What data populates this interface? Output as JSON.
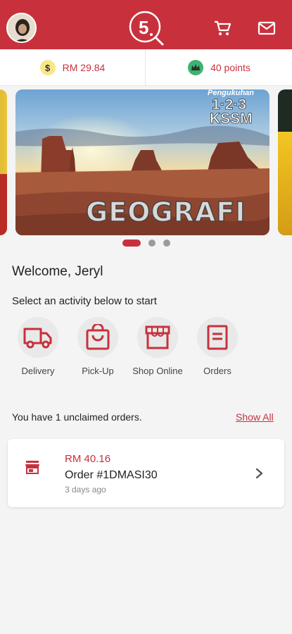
{
  "header": {
    "logo_text": "5",
    "accent_color": "#c8313c"
  },
  "balance": {
    "cash_symbol": "$",
    "cash": "RM 29.84",
    "points": "40 points"
  },
  "banner": {
    "title": "GEOGRAFI",
    "kicker": "Pengukuhan",
    "number": "1·2·3",
    "subject": "KSSM",
    "slide_count": 3,
    "active_slide": 1
  },
  "welcome": {
    "greeting": "Welcome, Jeryl",
    "instruction": "Select an activity below to start"
  },
  "activities": [
    {
      "label": "Delivery",
      "icon": "truck-icon"
    },
    {
      "label": "Pick-Up",
      "icon": "shopping-bag-icon"
    },
    {
      "label": "Shop Online",
      "icon": "storefront-icon"
    },
    {
      "label": "Orders",
      "icon": "receipt-icon"
    }
  ],
  "unclaimed": {
    "message": "You have 1 unclaimed orders.",
    "show_all": "Show All"
  },
  "order": {
    "amount": "RM 40.16",
    "id": "Order #1DMASI30",
    "time": "3 days ago"
  }
}
